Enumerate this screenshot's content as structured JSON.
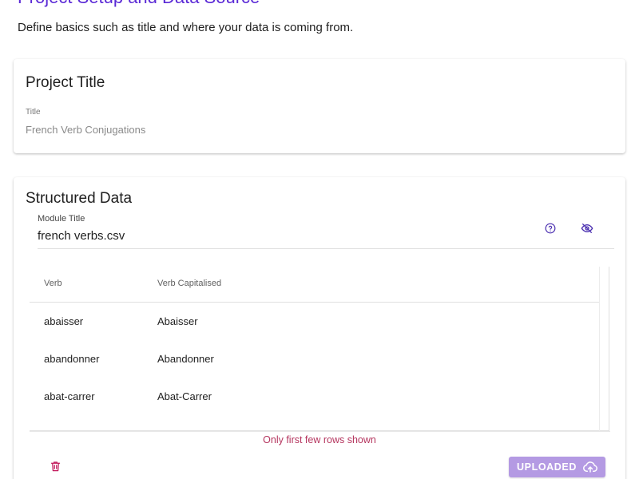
{
  "header": {
    "title": "Project Setup and Data Source",
    "subtitle": "Define basics such as title and where your data is coming from."
  },
  "project_card": {
    "title": "Project Title",
    "field_label": "Title",
    "field_value": "French Verb Conjugations"
  },
  "structured_card": {
    "title": "Structured Data",
    "module_label": "Module Title",
    "module_value": "french verbs.csv",
    "icons": {
      "help": "help-circle-icon",
      "visibility": "eye-off-icon",
      "delete": "trash-icon",
      "upload": "cloud-upload-icon"
    },
    "table": {
      "columns": [
        "Verb",
        "Verb Capitalised"
      ],
      "rows": [
        [
          "abaisser",
          "Abaisser"
        ],
        [
          "abandonner",
          "Abandonner"
        ],
        [
          "abat-carrer",
          "Abat-Carrer"
        ]
      ]
    },
    "notice": "Only first few rows shown",
    "upload_label": "UPLOADED"
  },
  "colors": {
    "accent": "#5b2ad6",
    "notice": "#b5365f",
    "upload_button": "#b49ae3",
    "delete_icon": "#c2185b"
  }
}
